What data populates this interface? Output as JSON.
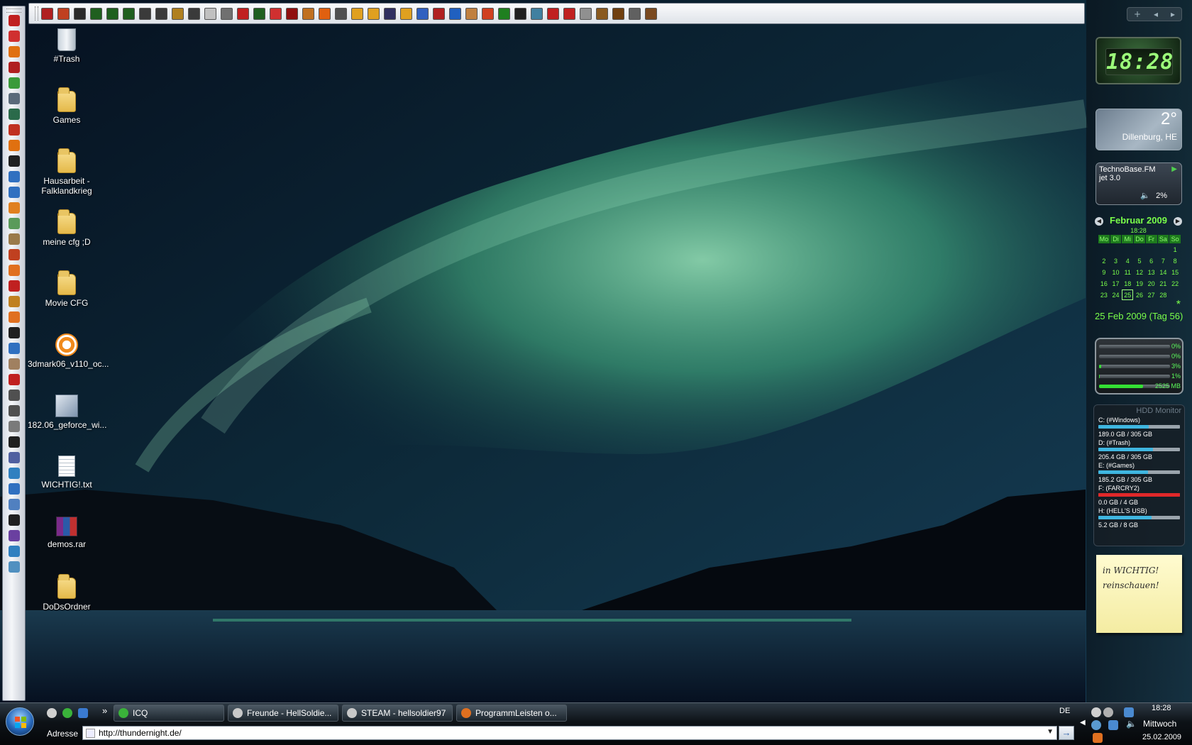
{
  "desktop": {
    "icons": [
      {
        "label": "#Trash",
        "icon": "recycle-bin-icon"
      },
      {
        "label": "Games",
        "icon": "folder-icon"
      },
      {
        "label": "Hausarbeit - Falklandkrieg",
        "icon": "folder-icon"
      },
      {
        "label": "meine cfg ;D",
        "icon": "folder-icon"
      },
      {
        "label": "Movie CFG",
        "icon": "folder-icon"
      },
      {
        "label": "3dmark06_v110_oc...",
        "icon": "installer-icon"
      },
      {
        "label": "182.06_geforce_wi...",
        "icon": "driver-installer-icon"
      },
      {
        "label": "WICHTIG!.txt",
        "icon": "text-file-icon"
      },
      {
        "label": "demos.rar",
        "icon": "rar-archive-icon"
      },
      {
        "label": "DoDsOrdner",
        "icon": "folder-shortcut-icon"
      }
    ]
  },
  "top_toolbar": {
    "icon_colors": [
      "#b02020",
      "#c04020",
      "#2a2a2a",
      "#1f5f1f",
      "#1f5f1f",
      "#1f5f1f",
      "#3a3a3a",
      "#3a3a3a",
      "#b08020",
      "#3a3a3a",
      "#c0c0c0",
      "#707070",
      "#c02020",
      "#1f5f1f",
      "#d03030",
      "#901010",
      "#c07020",
      "#e06010",
      "#505050",
      "#e0a020",
      "#e0a020",
      "#303060",
      "#e0a020",
      "#3060c0",
      "#b02020",
      "#2060c0",
      "#c08040",
      "#d04020",
      "#1f7f1f",
      "#202020",
      "#4080a0",
      "#c02020",
      "#c02020",
      "#909090",
      "#8a5a20",
      "#704010",
      "#606060",
      "#7a4a20"
    ]
  },
  "left_toolbar": {
    "icon_colors": [
      "#c02020",
      "#d03030",
      "#e07010",
      "#b02020",
      "#3a9a3a",
      "#5a6a7a",
      "#2a6a4a",
      "#c03020",
      "#e07010",
      "#202020",
      "#3070c0",
      "#3070c0",
      "#e08020",
      "#5a9a5a",
      "#9a7a4a",
      "#c04020",
      "#e07020",
      "#c02020",
      "#c08020",
      "#e07020",
      "#202020",
      "#3070c0",
      "#a08060",
      "#c02020",
      "#505050",
      "#505050",
      "#7a7a7a",
      "#202020",
      "#5060a0",
      "#3080c0",
      "#3070c0",
      "#5080c0",
      "#202020",
      "#6a40a0",
      "#3080c0",
      "#5090c0"
    ]
  },
  "sidebar": {
    "controls": [
      "+",
      "◂",
      "▸"
    ],
    "clock": {
      "time": "18:28"
    },
    "weather": {
      "temp": "2°",
      "location": "Dillenburg, HE"
    },
    "radio": {
      "station": "TechnoBase.FM",
      "player": "jet 3.0",
      "volume": "2%"
    },
    "calendar": {
      "month": "Februar 2009",
      "time": "18:28",
      "weekdays": [
        "Mo",
        "Di",
        "Mi",
        "Do",
        "Fr",
        "Sa",
        "So"
      ],
      "weeks": [
        [
          "",
          "",
          "",
          "",
          "",
          "",
          "1"
        ],
        [
          "2",
          "3",
          "4",
          "5",
          "6",
          "7",
          "8"
        ],
        [
          "9",
          "10",
          "11",
          "12",
          "13",
          "14",
          "15"
        ],
        [
          "16",
          "17",
          "18",
          "19",
          "20",
          "21",
          "22"
        ],
        [
          "23",
          "24",
          "25",
          "26",
          "27",
          "28",
          ""
        ]
      ],
      "today": "25",
      "asterisk": "*",
      "footer": "25 Feb 2009 (Tag 56)"
    },
    "cpu_meter": {
      "rows": [
        {
          "value": "0%",
          "fraction": 0.0
        },
        {
          "value": "0%",
          "fraction": 0.0
        },
        {
          "value": "3%",
          "fraction": 0.03
        },
        {
          "value": "1%",
          "fraction": 0.01
        },
        {
          "value": "2525 MB",
          "fraction": 0.62
        }
      ]
    },
    "hdd_monitor": {
      "title": "HDD Monitor",
      "drives": [
        {
          "name": "C: (#Windows)",
          "usage": "189.0 GB / 305 GB",
          "fraction": 0.62,
          "color": "#3fb6e0"
        },
        {
          "name": "D: (#Trash)",
          "usage": "205.4 GB / 305 GB",
          "fraction": 0.67,
          "color": "#3fb6e0"
        },
        {
          "name": "E: (#Games)",
          "usage": "185.2 GB / 305 GB",
          "fraction": 0.61,
          "color": "#3fb6e0"
        },
        {
          "name": "F: (FARCRY2)",
          "usage": "0.0 GB / 4 GB",
          "fraction": 1.0,
          "color": "#e0282a"
        },
        {
          "name": "H: (HELL'S USB)",
          "usage": "5.2 GB / 8 GB",
          "fraction": 0.65,
          "color": "#3fb6e0"
        }
      ]
    },
    "note": {
      "line1": "in WICHTIG!",
      "line2": "reinschauen!"
    }
  },
  "taskbar": {
    "buttons": [
      {
        "label": "ICQ",
        "icon": "icq-flower-icon",
        "icon_color": "#3ab23a"
      },
      {
        "label": "Freunde - HellSoldie...",
        "icon": "steam-icon",
        "icon_color": "#c8c8c8"
      },
      {
        "label": "STEAM - hellsoldier97",
        "icon": "steam-icon",
        "icon_color": "#c8c8c8"
      },
      {
        "label": "ProgrammLeisten o...",
        "icon": "firefox-icon",
        "icon_color": "#e07020"
      }
    ],
    "quick_launch_overflow": "»",
    "address_label": "Adresse",
    "address_value": "http://thundernight.de/",
    "go_symbol": "→",
    "dropdown_symbol": "▼",
    "language": "DE",
    "tray_time": "18:28",
    "tray_day": "Mittwoch",
    "tray_date": "25.02.2009"
  },
  "colors": {
    "accent_green": "#7aff4a",
    "aurora": "#7fe3a8",
    "sky_dark": "#061120"
  }
}
